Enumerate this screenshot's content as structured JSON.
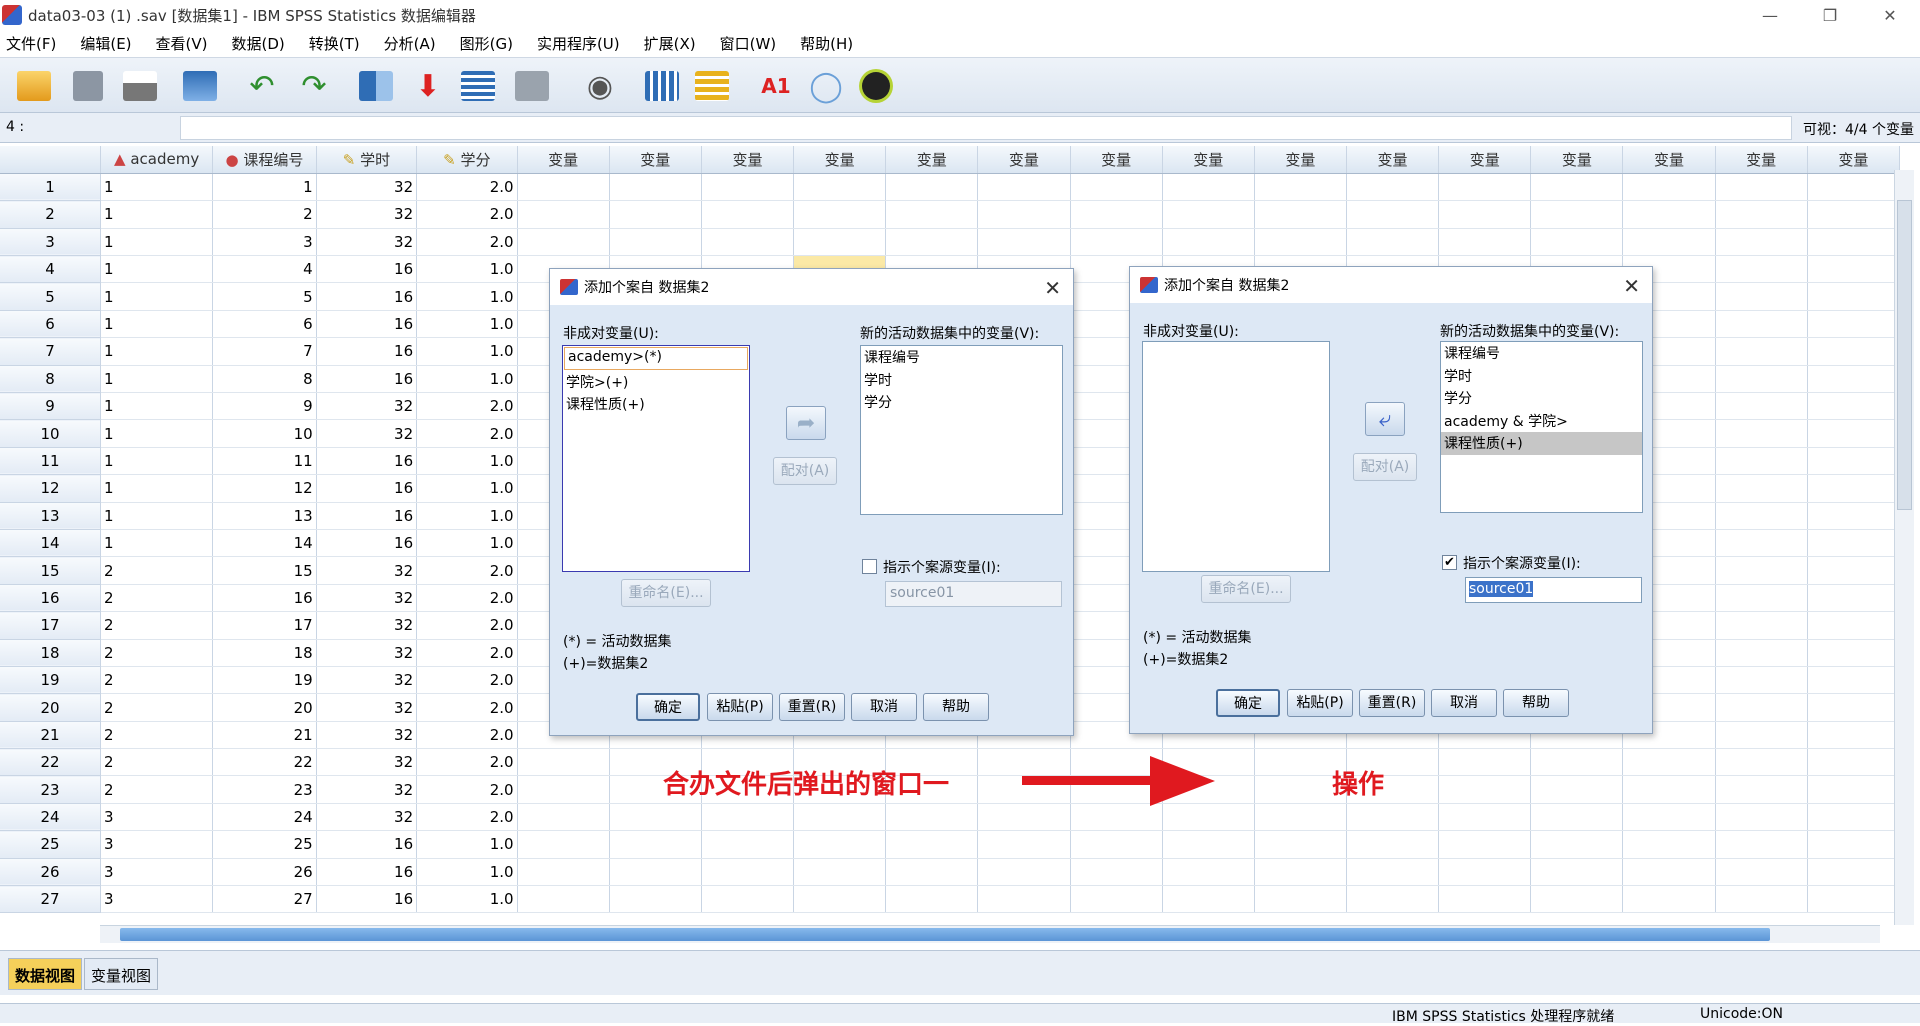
{
  "window": {
    "title": "data03-03 (1) .sav [数据集1] - IBM SPSS Statistics 数据编辑器"
  },
  "menu": [
    "文件(F)",
    "编辑(E)",
    "查看(V)",
    "数据(D)",
    "转换(T)",
    "分析(A)",
    "图形(G)",
    "实用程序(U)",
    "扩展(X)",
    "窗口(W)",
    "帮助(H)"
  ],
  "cellbar": {
    "ref": "4 :",
    "visible": "可视：4/4 个变量"
  },
  "grid": {
    "headers": [
      "academy",
      "课程编号",
      "学时",
      "学分"
    ],
    "empty_header": "变量",
    "rows": [
      [
        "1",
        "1",
        "1",
        "32",
        "2.0"
      ],
      [
        "2",
        "1",
        "2",
        "32",
        "2.0"
      ],
      [
        "3",
        "1",
        "3",
        "32",
        "2.0"
      ],
      [
        "4",
        "1",
        "4",
        "16",
        "1.0"
      ],
      [
        "5",
        "1",
        "5",
        "16",
        "1.0"
      ],
      [
        "6",
        "1",
        "6",
        "16",
        "1.0"
      ],
      [
        "7",
        "1",
        "7",
        "16",
        "1.0"
      ],
      [
        "8",
        "1",
        "8",
        "16",
        "1.0"
      ],
      [
        "9",
        "1",
        "9",
        "32",
        "2.0"
      ],
      [
        "10",
        "1",
        "10",
        "32",
        "2.0"
      ],
      [
        "11",
        "1",
        "11",
        "16",
        "1.0"
      ],
      [
        "12",
        "1",
        "12",
        "16",
        "1.0"
      ],
      [
        "13",
        "1",
        "13",
        "16",
        "1.0"
      ],
      [
        "14",
        "1",
        "14",
        "16",
        "1.0"
      ],
      [
        "15",
        "2",
        "15",
        "32",
        "2.0"
      ],
      [
        "16",
        "2",
        "16",
        "32",
        "2.0"
      ],
      [
        "17",
        "2",
        "17",
        "32",
        "2.0"
      ],
      [
        "18",
        "2",
        "18",
        "32",
        "2.0"
      ],
      [
        "19",
        "2",
        "19",
        "32",
        "2.0"
      ],
      [
        "20",
        "2",
        "20",
        "32",
        "2.0"
      ],
      [
        "21",
        "2",
        "21",
        "32",
        "2.0"
      ],
      [
        "22",
        "2",
        "22",
        "32",
        "2.0"
      ],
      [
        "23",
        "2",
        "23",
        "32",
        "2.0"
      ],
      [
        "24",
        "3",
        "24",
        "32",
        "2.0"
      ],
      [
        "25",
        "3",
        "25",
        "16",
        "1.0"
      ],
      [
        "26",
        "3",
        "26",
        "16",
        "1.0"
      ],
      [
        "27",
        "3",
        "27",
        "16",
        "1.0"
      ]
    ]
  },
  "dialog1": {
    "title": "添加个案自 数据集2",
    "unpaired_label": "非成对变量(U):",
    "unpaired": [
      "academy>(*)",
      "学院>(+)",
      "课程性质(+)"
    ],
    "new_label": "新的活动数据集中的变量(V):",
    "new_vars": [
      "课程编号",
      "学时",
      "学分"
    ],
    "pair_btn": "配对(A)",
    "rename_btn": "重命名(E)...",
    "indicator_label": "指示个案源变量(I):",
    "indicator_value": "source01",
    "legend1": "(*) = 活动数据集",
    "legend2": "(+)=数据集2",
    "ok": "确定",
    "paste": "粘贴(P)",
    "reset": "重置(R)",
    "cancel": "取消",
    "help": "帮助"
  },
  "dialog2": {
    "title": "添加个案自 数据集2",
    "unpaired_label": "非成对变量(U):",
    "new_label": "新的活动数据集中的变量(V):",
    "new_vars": [
      "课程编号",
      "学时",
      "学分",
      "academy & 学院>",
      "课程性质(+)"
    ],
    "pair_btn": "配对(A)",
    "rename_btn": "重命名(E)...",
    "indicator_label": "指示个案源变量(I):",
    "indicator_value": "source01",
    "legend1": "(*) = 活动数据集",
    "legend2": "(+)=数据集2",
    "ok": "确定",
    "paste": "粘贴(P)",
    "reset": "重置(R)",
    "cancel": "取消",
    "help": "帮助"
  },
  "annotations": {
    "left": "合办文件后弹出的窗口一",
    "right": "操作"
  },
  "tabs": {
    "data_view": "数据视图",
    "variable_view": "变量视图"
  },
  "status": {
    "processor": "IBM SPSS Statistics 处理程序就绪",
    "unicode": "Unicode:ON"
  },
  "colors": {
    "accent": "#e0191f",
    "selection": "#c6c6c6",
    "active_tab": "#f5d05a"
  }
}
